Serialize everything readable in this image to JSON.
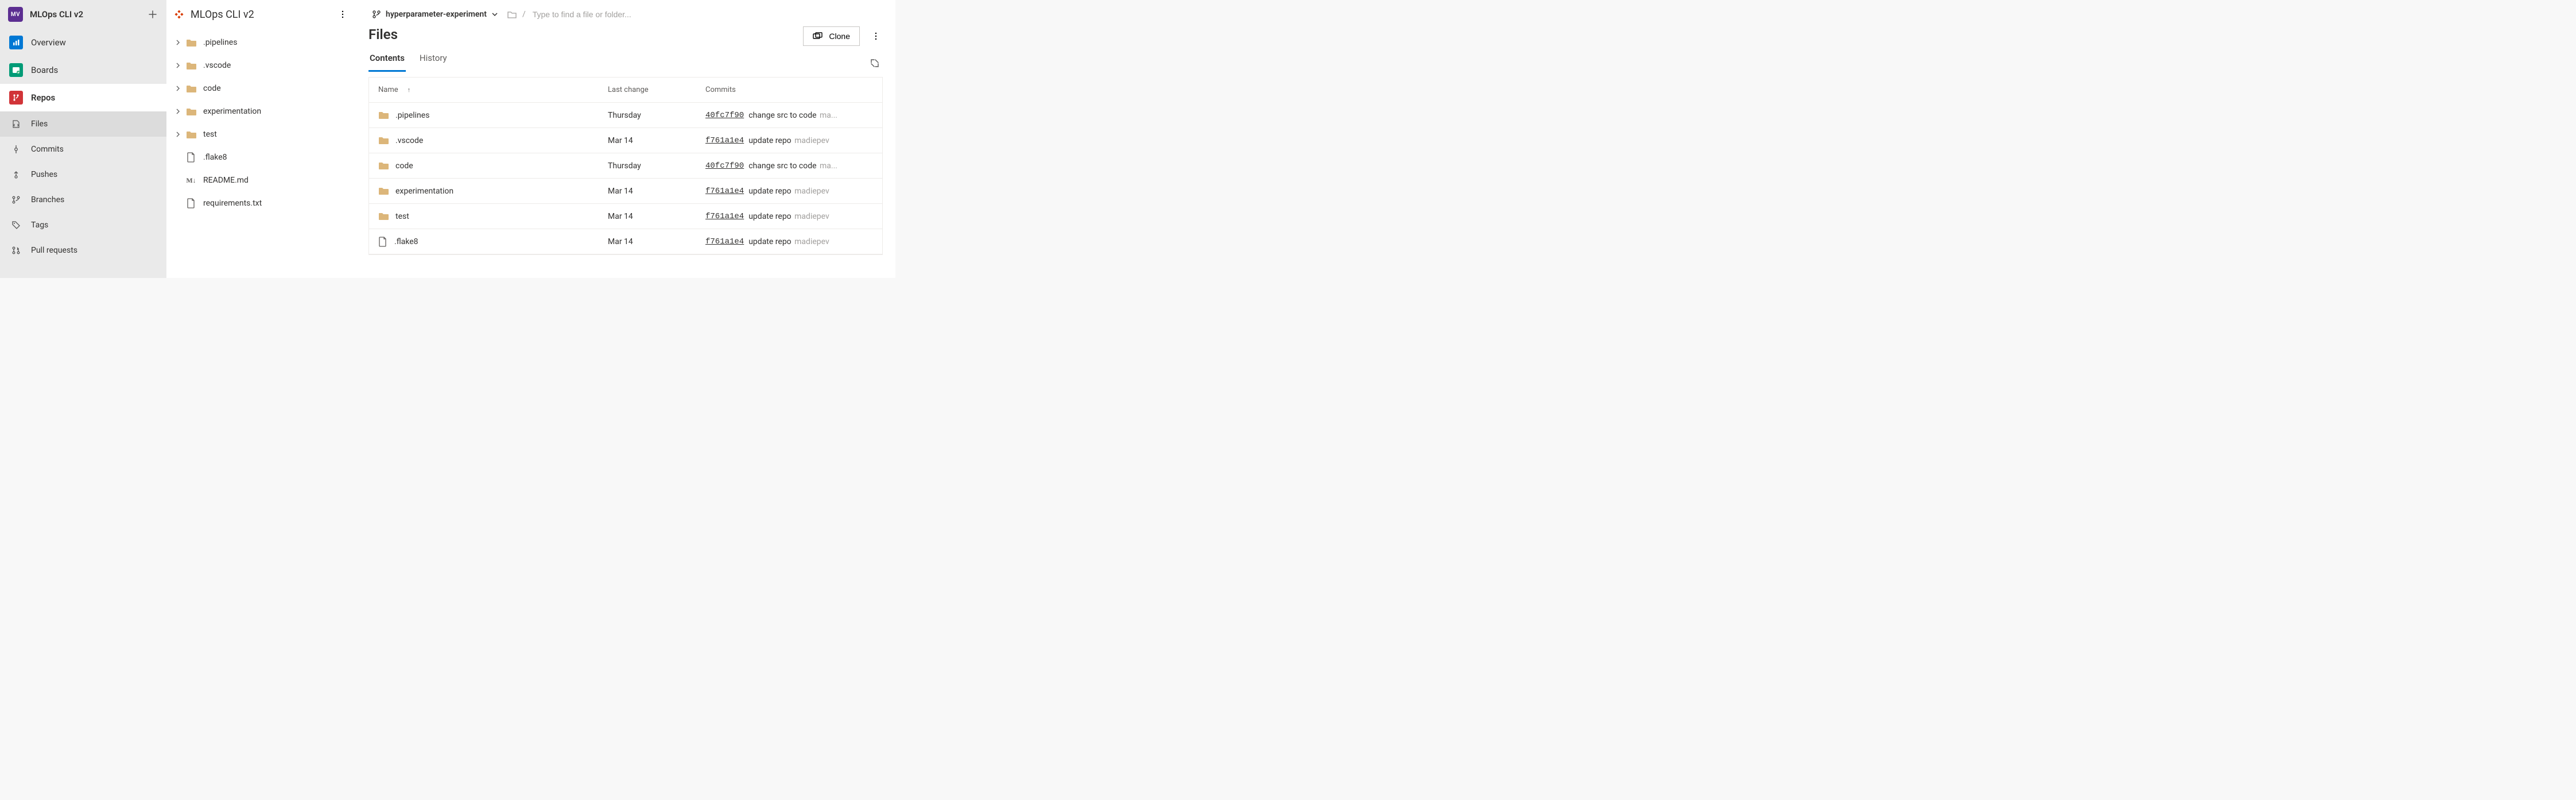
{
  "project": {
    "badge": "MV",
    "name": "MLOps CLI v2"
  },
  "nav": {
    "sections": [
      {
        "key": "overview",
        "label": "Overview",
        "color": "#0078d4",
        "active": false
      },
      {
        "key": "boards",
        "label": "Boards",
        "color": "#009b77",
        "active": false
      },
      {
        "key": "repos",
        "label": "Repos",
        "color": "#d13438",
        "active": true
      }
    ],
    "subs": [
      {
        "key": "files",
        "label": "Files",
        "active": true
      },
      {
        "key": "commits",
        "label": "Commits",
        "active": false
      },
      {
        "key": "pushes",
        "label": "Pushes",
        "active": false
      },
      {
        "key": "branches",
        "label": "Branches",
        "active": false
      },
      {
        "key": "tags",
        "label": "Tags",
        "active": false
      },
      {
        "key": "prs",
        "label": "Pull requests",
        "active": false
      }
    ]
  },
  "repo": {
    "name": "MLOps CLI v2",
    "branch": "hyperparameter-experiment",
    "path_placeholder": "Type to find a file or folder..."
  },
  "tree": [
    {
      "type": "folder",
      "name": ".pipelines"
    },
    {
      "type": "folder",
      "name": ".vscode"
    },
    {
      "type": "folder",
      "name": "code"
    },
    {
      "type": "folder",
      "name": "experimentation"
    },
    {
      "type": "folder",
      "name": "test"
    },
    {
      "type": "file",
      "name": ".flake8"
    },
    {
      "type": "md",
      "name": "README.md"
    },
    {
      "type": "file",
      "name": "requirements.txt"
    }
  ],
  "main": {
    "page_title": "Files",
    "clone_label": "Clone",
    "tabs": [
      {
        "key": "contents",
        "label": "Contents",
        "active": true
      },
      {
        "key": "history",
        "label": "History",
        "active": false
      }
    ],
    "columns": {
      "name": "Name",
      "change": "Last change",
      "commits": "Commits"
    }
  },
  "rows": [
    {
      "type": "folder",
      "name": ".pipelines",
      "change": "Thursday",
      "hash": "40fc7f90",
      "msg": "change src to code",
      "author_suffix": "ma..."
    },
    {
      "type": "folder",
      "name": ".vscode",
      "change": "Mar 14",
      "hash": "f761a1e4",
      "msg": "update repo",
      "author_suffix": "madiepev"
    },
    {
      "type": "folder",
      "name": "code",
      "change": "Thursday",
      "hash": "40fc7f90",
      "msg": "change src to code",
      "author_suffix": "ma..."
    },
    {
      "type": "folder",
      "name": "experimentation",
      "change": "Mar 14",
      "hash": "f761a1e4",
      "msg": "update repo",
      "author_suffix": "madiepev"
    },
    {
      "type": "folder",
      "name": "test",
      "change": "Mar 14",
      "hash": "f761a1e4",
      "msg": "update repo",
      "author_suffix": "madiepev"
    },
    {
      "type": "file",
      "name": ".flake8",
      "change": "Mar 14",
      "hash": "f761a1e4",
      "msg": "update repo",
      "author_suffix": "madiepev"
    }
  ]
}
